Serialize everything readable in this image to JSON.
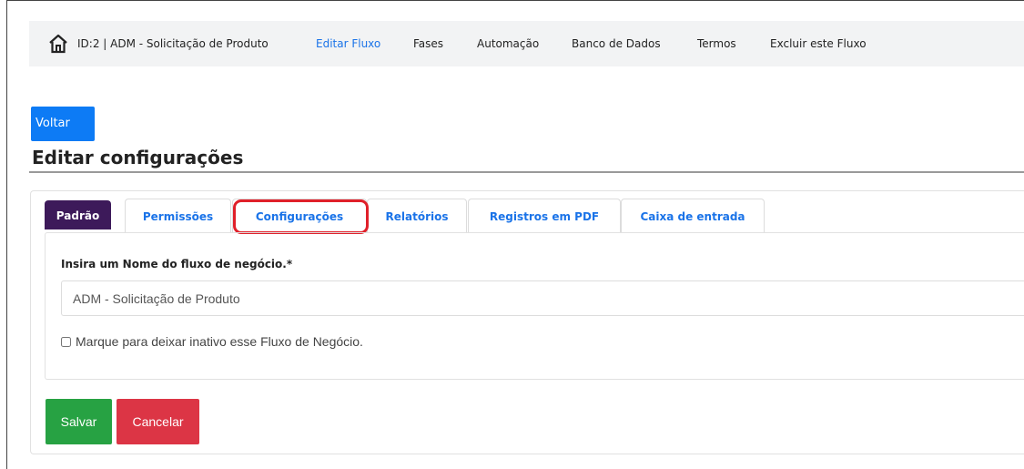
{
  "nav": {
    "title": "ID:2 | ADM - Solicitação de Produto",
    "links": [
      {
        "label": "Editar Fluxo",
        "active": true
      },
      {
        "label": "Fases"
      },
      {
        "label": "Automação"
      },
      {
        "label": "Banco de Dados"
      },
      {
        "label": "Termos"
      },
      {
        "label": "Excluir este Fluxo"
      }
    ],
    "home_icon": "home-icon"
  },
  "back_button": "Voltar",
  "page_title": "Editar configurações",
  "tabs": [
    {
      "label": "Padrão",
      "active": true
    },
    {
      "label": "Permissões"
    },
    {
      "label": "Configurações",
      "highlighted": true
    },
    {
      "label": "Relatórios"
    },
    {
      "label": "Registros em PDF"
    },
    {
      "label": "Caixa de entrada"
    }
  ],
  "form": {
    "name_label": "Insira um Nome do fluxo de negócio.*",
    "name_value": "ADM - Solicitação de Produto",
    "inactive_checkbox_label": "Marque para deixar inativo esse Fluxo de Negócio.",
    "inactive_checked": false
  },
  "actions": {
    "save": "Salvar",
    "cancel": "Cancelar"
  },
  "colors": {
    "primary": "#0d7bf5",
    "tab_active": "#3d1a5a",
    "highlight": "#e0202a",
    "save": "#27a243",
    "cancel": "#dc3545"
  }
}
